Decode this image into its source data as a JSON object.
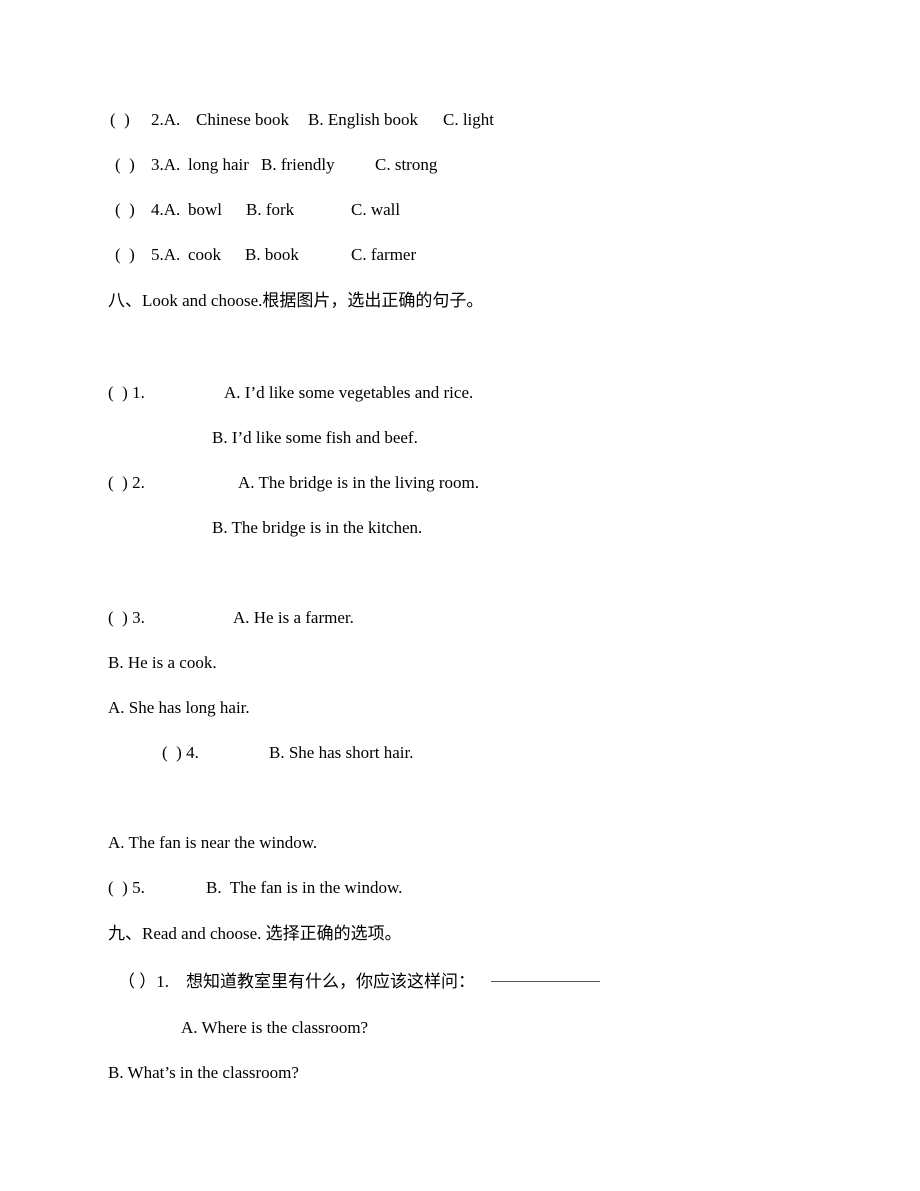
{
  "part7_continued": {
    "items": [
      {
        "bracket": "(  )",
        "num": "2.A.",
        "a": "Chinese book",
        "b": "B. English book",
        "c": "C. light"
      },
      {
        "bracket": "(  )",
        "num": "3.A.",
        "a": "long hair",
        "b": "B. friendly",
        "c": "C. strong"
      },
      {
        "bracket": "(  )",
        "num": "4.A.",
        "a": "bowl",
        "b": "B. fork",
        "c": "C. wall"
      },
      {
        "bracket": "(  )",
        "num": "5.A.",
        "a": "cook",
        "b": "B. book",
        "c": "C. farmer"
      }
    ]
  },
  "part8": {
    "heading": "八、Look and choose.根据图片，选出正确的句子。",
    "q1": {
      "label": "(  ) 1.",
      "a": "A. I’d like some vegetables and rice.",
      "b": "B. I’d like some fish and beef."
    },
    "q2": {
      "label": "(  ) 2.",
      "a": "A. The bridge is in the living room.",
      "b": "B. The bridge is in the kitchen."
    },
    "q3": {
      "label": "(  ) 3.",
      "a": "A. He is a farmer.",
      "b": "B. He is a cook."
    },
    "q4": {
      "label": "(  ) 4.",
      "a": "A. She has long hair.",
      "b": "B. She has short hair."
    },
    "q5": {
      "label": "(  ) 5.",
      "a": "A. The fan is near the window.",
      "b": "B.  The fan is in the window."
    }
  },
  "part9": {
    "heading": "九、Read and choose. 选择正确的选项。",
    "q1": {
      "label": "（ ）1.",
      "prompt": "想知道教室里有什么，你应该这样问：",
      "a": "A. Where is the classroom?",
      "b": "B. What’s in the classroom?"
    }
  }
}
